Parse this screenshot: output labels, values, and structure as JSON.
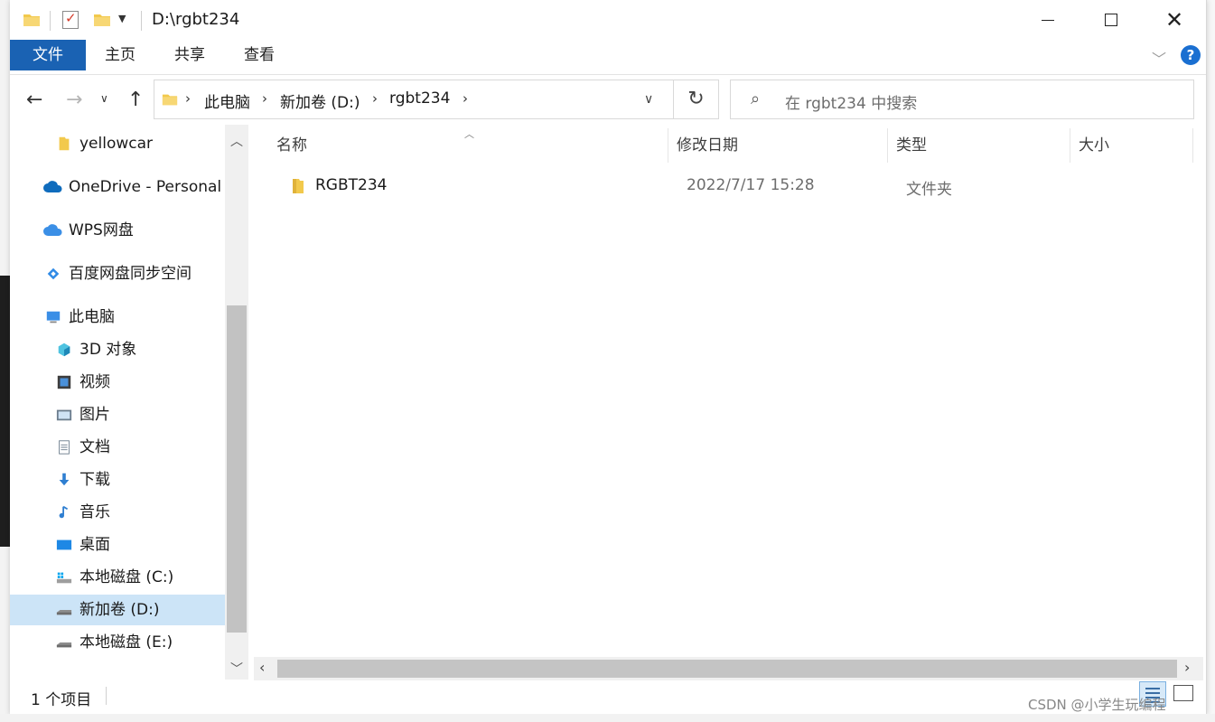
{
  "window": {
    "title": "D:\\rgbt234"
  },
  "ribbon": {
    "tabs": [
      {
        "label": "文件",
        "active": true
      },
      {
        "label": "主页"
      },
      {
        "label": "共享"
      },
      {
        "label": "查看"
      }
    ],
    "help_label": "?"
  },
  "address": {
    "crumbs": [
      "此电脑",
      "新加卷 (D:)",
      "rgbt234"
    ]
  },
  "search": {
    "placeholder": "在 rgbt234 中搜索"
  },
  "nav": {
    "items": [
      {
        "label": "yellowcar",
        "icon": "folder-icon"
      },
      {
        "label": "OneDrive - Personal",
        "icon": "onedrive-cloud-icon"
      },
      {
        "label": "WPS网盘",
        "icon": "wps-cloud-icon"
      },
      {
        "label": "百度网盘同步空间",
        "icon": "baidu-netdisk-icon"
      },
      {
        "label": "此电脑",
        "icon": "this-pc-icon"
      },
      {
        "label": "3D 对象",
        "icon": "3d-objects-icon"
      },
      {
        "label": "视频",
        "icon": "videos-icon"
      },
      {
        "label": "图片",
        "icon": "pictures-icon"
      },
      {
        "label": "文档",
        "icon": "documents-icon"
      },
      {
        "label": "下载",
        "icon": "downloads-icon"
      },
      {
        "label": "音乐",
        "icon": "music-icon"
      },
      {
        "label": "桌面",
        "icon": "desktop-icon"
      },
      {
        "label": "本地磁盘 (C:)",
        "icon": "drive-c-icon"
      },
      {
        "label": "新加卷 (D:)",
        "icon": "drive-d-icon",
        "selected": true
      },
      {
        "label": "本地磁盘 (E:)",
        "icon": "drive-e-icon"
      }
    ]
  },
  "columns": [
    "名称",
    "修改日期",
    "类型",
    "大小"
  ],
  "files": [
    {
      "name": "RGBT234",
      "modified": "2022/7/17 15:28",
      "type": "文件夹",
      "size": ""
    }
  ],
  "status": {
    "item_count": "1 个项目"
  },
  "watermark": "CSDN @小学生玩编程",
  "colors": {
    "accent": "#1a62b3",
    "selected_bg": "#cce4f7",
    "folder": "#f2c94c"
  }
}
